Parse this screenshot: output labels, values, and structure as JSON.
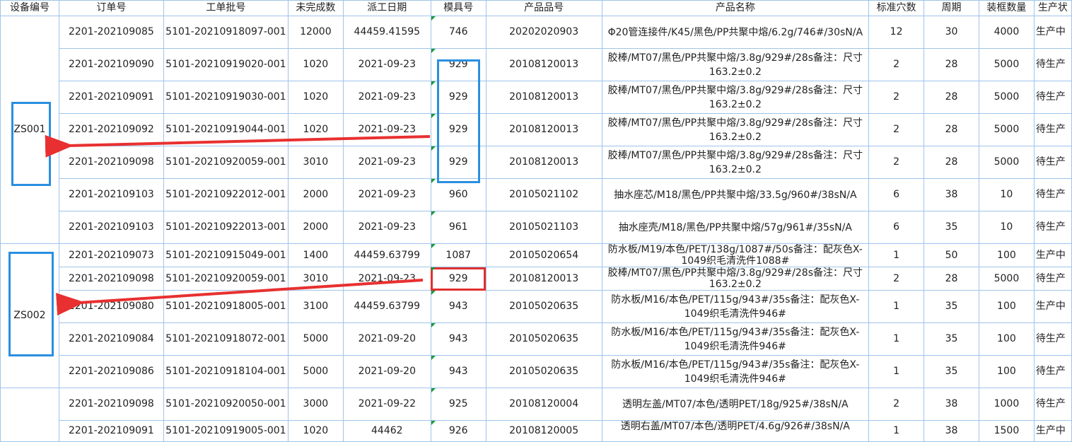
{
  "headers": [
    "设备编号",
    "订单号",
    "工单批号",
    "未完成数",
    "派工日期",
    "模具号",
    "产品品号",
    "产品名称",
    "标准穴数",
    "周期",
    "装框数量",
    "生产状"
  ],
  "groups": [
    {
      "device": "ZS001",
      "rows": [
        {
          "order": "2201-202109085",
          "batch": "5101-20210918097-001",
          "remaining": "12000",
          "date": "44459.41595",
          "mold": "746",
          "product_no": "20202020903",
          "product_name": "Φ20管连接件/K45/黑色/PP共聚中熔/6.2g/746#/30sN/A",
          "cavities": "12",
          "cycle": "30",
          "frame_qty": "4000",
          "status": "生产中"
        },
        {
          "order": "2201-202109090",
          "batch": "5101-20210919020-001",
          "remaining": "1020",
          "date": "2021-09-23",
          "mold": "929",
          "product_no": "20108120013",
          "product_name": "胶棒/MT07/黑色/PP共聚中熔/3.8g/929#/28s备注：尺寸163.2±0.2",
          "cavities": "2",
          "cycle": "28",
          "frame_qty": "5000",
          "status": "待生产"
        },
        {
          "order": "2201-202109091",
          "batch": "5101-20210919030-001",
          "remaining": "1020",
          "date": "2021-09-23",
          "mold": "929",
          "product_no": "20108120013",
          "product_name": "胶棒/MT07/黑色/PP共聚中熔/3.8g/929#/28s备注：尺寸163.2±0.2",
          "cavities": "2",
          "cycle": "28",
          "frame_qty": "5000",
          "status": "待生产"
        },
        {
          "order": "2201-202109092",
          "batch": "5101-20210919044-001",
          "remaining": "1020",
          "date": "2021-09-23",
          "mold": "929",
          "product_no": "20108120013",
          "product_name": "胶棒/MT07/黑色/PP共聚中熔/3.8g/929#/28s备注：尺寸163.2±0.2",
          "cavities": "2",
          "cycle": "28",
          "frame_qty": "5000",
          "status": "待生产"
        },
        {
          "order": "2201-202109098",
          "batch": "5101-20210920059-001",
          "remaining": "3010",
          "date": "2021-09-23",
          "mold": "929",
          "product_no": "20108120013",
          "product_name": "胶棒/MT07/黑色/PP共聚中熔/3.8g/929#/28s备注：尺寸163.2±0.2",
          "cavities": "2",
          "cycle": "28",
          "frame_qty": "5000",
          "status": "待生产"
        },
        {
          "order": "2201-202109103",
          "batch": "5101-20210922012-001",
          "remaining": "2000",
          "date": "2021-09-23",
          "mold": "960",
          "product_no": "20105021102",
          "product_name": "抽水座芯/M18/黑色/PP共聚中熔/33.5g/960#/38sN/A",
          "cavities": "6",
          "cycle": "38",
          "frame_qty": "10",
          "status": "待生产"
        },
        {
          "order": "2201-202109103",
          "batch": "5101-20210922013-001",
          "remaining": "2000",
          "date": "2021-09-23",
          "mold": "961",
          "product_no": "20105021103",
          "product_name": "抽水座壳/M18/黑色/PP共聚中熔/57g/961#/35sN/A",
          "cavities": "6",
          "cycle": "35",
          "frame_qty": "10",
          "status": "待生产"
        }
      ]
    },
    {
      "device": "ZS002",
      "rows": [
        {
          "order": "2201-202109073",
          "batch": "5101-20210915049-001",
          "remaining": "1400",
          "date": "44459.63799",
          "mold": "1087",
          "product_no": "20105020654",
          "product_name": "防水板/M19/本色/PET/138g/1087#/50s备注：配灰色X-1049织毛清洗件1088#",
          "cavities": "1",
          "cycle": "50",
          "frame_qty": "100",
          "status": "生产中"
        },
        {
          "order": "2201-202109098",
          "batch": "5101-20210920059-001",
          "remaining": "3010",
          "date": "2021-09-23",
          "mold": "929",
          "product_no": "20108120013",
          "product_name": "胶棒/MT07/黑色/PP共聚中熔/3.8g/929#/28s备注：尺寸163.2±0.2",
          "cavities": "2",
          "cycle": "28",
          "frame_qty": "5000",
          "status": "待生产"
        },
        {
          "order": "2201-202109080",
          "batch": "5101-20210918005-001",
          "remaining": "3100",
          "date": "44459.63799",
          "mold": "943",
          "product_no": "20105020635",
          "product_name": "防水板/M16/本色/PET/115g/943#/35s备注：配灰色X-1049织毛清洗件946#",
          "cavities": "1",
          "cycle": "35",
          "frame_qty": "100",
          "status": "生产中"
        },
        {
          "order": "2201-202109084",
          "batch": "5101-20210918072-001",
          "remaining": "5000",
          "date": "2021-09-20",
          "mold": "943",
          "product_no": "20105020635",
          "product_name": "防水板/M16/本色/PET/115g/943#/35s备注：配灰色X-1049织毛清洗件946#",
          "cavities": "1",
          "cycle": "35",
          "frame_qty": "100",
          "status": "待生产"
        },
        {
          "order": "2201-202109086",
          "batch": "5101-20210918104-001",
          "remaining": "5000",
          "date": "2021-09-20",
          "mold": "943",
          "product_no": "20105020635",
          "product_name": "防水板/M16/本色/PET/115g/943#/35s备注：配灰色X-1049织毛清洗件946#",
          "cavities": "1",
          "cycle": "35",
          "frame_qty": "100",
          "status": "待生产"
        }
      ]
    },
    {
      "device": "",
      "rows": [
        {
          "order": "2201-202109098",
          "batch": "5101-20210920050-001",
          "remaining": "3000",
          "date": "2021-09-22",
          "mold": "925",
          "product_no": "20108120004",
          "product_name": "透明左盖/MT07/本色/透明PET/18g/925#/38sN/A",
          "cavities": "2",
          "cycle": "38",
          "frame_qty": "1000",
          "status": "待生产"
        },
        {
          "order": "2201-202109091",
          "batch": "5101-20210919005-001",
          "remaining": "1020",
          "date": "44462",
          "mold": "926",
          "product_no": "20108120005",
          "product_name": "透明右盖/MT07/本色/透明PET/4.6g/926#/38sN/A",
          "cavities": "1",
          "cycle": "38",
          "frame_qty": "1500",
          "status": "生产中"
        }
      ]
    }
  ],
  "colors": {
    "grid": "#9fc4ea",
    "annotation_blue": "#2a8fe0",
    "arrow_red": "#e83030",
    "selected_red": "#e03030",
    "comment_marker": "#1a9b3f"
  }
}
